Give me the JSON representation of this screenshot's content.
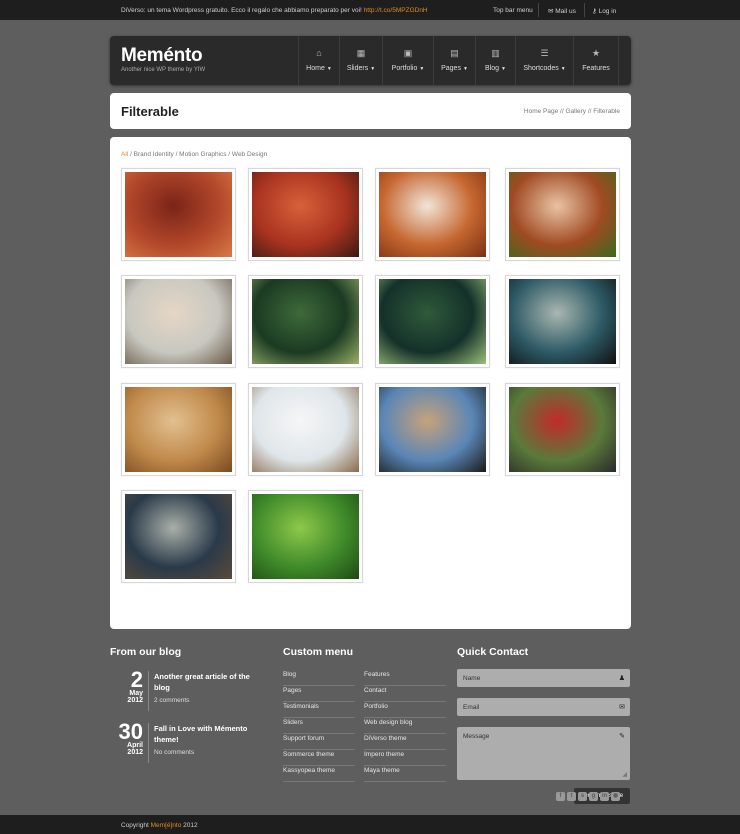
{
  "topbar": {
    "message": "DiVerso: un tema Wordpress gratuito. Ecco il regalo che abbiamo preparato per voi!",
    "link": "http://t.co/5MPZGDnH",
    "menu": "Top bar menu",
    "mail": "Mail us",
    "login": "Log in"
  },
  "header": {
    "logo": "Meménto",
    "tagline": "Another nice WP theme by YIW",
    "nav": [
      {
        "label": "Home",
        "icon": "home-icon",
        "caret": true
      },
      {
        "label": "Sliders",
        "icon": "film-icon",
        "caret": true
      },
      {
        "label": "Portfolio",
        "icon": "image-icon",
        "caret": true
      },
      {
        "label": "Pages",
        "icon": "page-icon",
        "caret": true
      },
      {
        "label": "Blog",
        "icon": "calendar-icon",
        "caret": true
      },
      {
        "label": "Shortcodes",
        "icon": "list-icon",
        "caret": true
      },
      {
        "label": "Features",
        "icon": "star-icon",
        "caret": false
      }
    ]
  },
  "page": {
    "title": "Filterable",
    "breadcrumb": "Home Page // Gallery // Filterable"
  },
  "filters": {
    "all": "All",
    "rest": " / Brand Identity / Motion Graphics / Web Design"
  },
  "gallery": [
    {
      "name": "umbrella-man",
      "colors": [
        "#b2472a",
        "#7a2418",
        "#d77a47"
      ]
    },
    {
      "name": "red-hoop-camera",
      "colors": [
        "#a8331f",
        "#d8613a",
        "#3a1a14"
      ]
    },
    {
      "name": "fedup-shirt",
      "colors": [
        "#c5662f",
        "#f1e5d8",
        "#7a3014"
      ]
    },
    {
      "name": "leaf-in-hand",
      "colors": [
        "#a04a22",
        "#e9c3a4",
        "#3a6a1e"
      ]
    },
    {
      "name": "child-portrait",
      "colors": [
        "#c8c8c0",
        "#e6d6c6",
        "#6a5a4a"
      ]
    },
    {
      "name": "green-flowers",
      "colors": [
        "#1b3a22",
        "#3e6a3a",
        "#9ab06a"
      ]
    },
    {
      "name": "lily-pads",
      "colors": [
        "#14312a",
        "#2f5a3a",
        "#9cc07a"
      ]
    },
    {
      "name": "lens-eye",
      "colors": [
        "#2d5a66",
        "#aab7b0",
        "#101010"
      ]
    },
    {
      "name": "cookies",
      "colors": [
        "#c0894a",
        "#e2c090",
        "#7a4a20"
      ]
    },
    {
      "name": "white-room",
      "colors": [
        "#dfe6ea",
        "#f6f6f6",
        "#8a6a4a"
      ]
    },
    {
      "name": "jumping-feet",
      "colors": [
        "#5a86b6",
        "#c7a27a",
        "#1a1a1a"
      ]
    },
    {
      "name": "kids-smiling",
      "colors": [
        "#5a7a3a",
        "#c22a2a",
        "#2a2a2a"
      ]
    },
    {
      "name": "shoes-pavement",
      "colors": [
        "#2a3a4a",
        "#aab0a8",
        "#5a4a3a"
      ]
    },
    {
      "name": "water-drops-leaf",
      "colors": [
        "#3f8a2a",
        "#8ec84a",
        "#1f4a14"
      ]
    }
  ],
  "blog": {
    "heading": "From our blog",
    "posts": [
      {
        "day": "2",
        "month": "May",
        "year": "2012",
        "title": "Another great article of the blog",
        "comments": "2 comments"
      },
      {
        "day": "30",
        "month": "April",
        "year": "2012",
        "title": "Fall in Love with Mémento theme!",
        "comments": "No comments"
      }
    ]
  },
  "custom_menu": {
    "heading": "Custom menu",
    "col1": [
      "Blog",
      "Pages",
      "Testimonials",
      "Sliders",
      "Support forum",
      "Sommerce theme",
      "Kassyopea theme"
    ],
    "col2": [
      "Features",
      "Contact",
      "Portfolio",
      "Web design blog",
      "DiVerso theme",
      "Impero theme",
      "Maya theme"
    ]
  },
  "contact": {
    "heading": "Quick Contact",
    "name_placeholder": "Name",
    "email_placeholder": "Email",
    "message_placeholder": "Message",
    "send_label": "send message"
  },
  "footer": {
    "copyright": "Copyright",
    "brand": "Mem[é]nto",
    "year": "2012",
    "social": [
      "facebook-icon",
      "twitter-icon",
      "skype-icon",
      "google-icon",
      "linkedin-icon",
      "rss-icon"
    ]
  }
}
